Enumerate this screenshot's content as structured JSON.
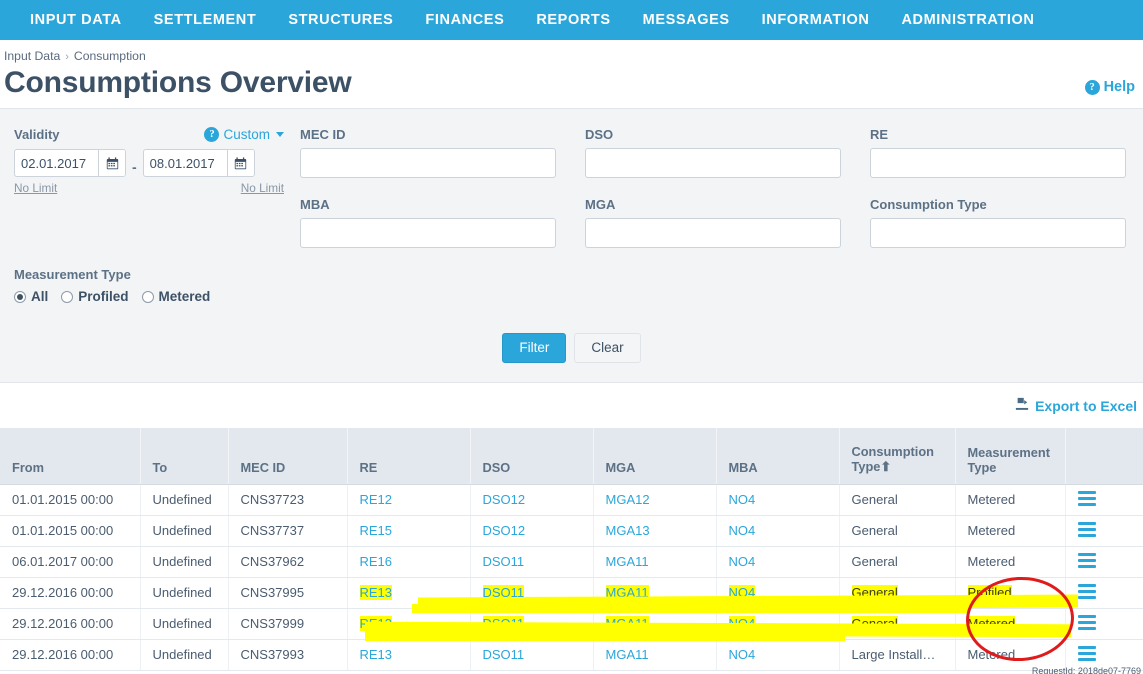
{
  "nav": {
    "items": [
      {
        "label": "INPUT DATA",
        "name": "nav-input-data"
      },
      {
        "label": "SETTLEMENT",
        "name": "nav-settlement"
      },
      {
        "label": "STRUCTURES",
        "name": "nav-structures"
      },
      {
        "label": "FINANCES",
        "name": "nav-finances"
      },
      {
        "label": "REPORTS",
        "name": "nav-reports"
      },
      {
        "label": "MESSAGES",
        "name": "nav-messages"
      },
      {
        "label": "INFORMATION",
        "name": "nav-information"
      },
      {
        "label": "ADMINISTRATION",
        "name": "nav-administration"
      }
    ]
  },
  "breadcrumb": {
    "root": "Input Data",
    "separator": "›",
    "current": "Consumption"
  },
  "header": {
    "title": "Consumptions Overview",
    "help_label": "Help",
    "help_icon": "question-circle-icon"
  },
  "filters": {
    "validity": {
      "label": "Validity",
      "preset_label": "Custom",
      "preset_icon": "question-circle-icon",
      "from_value": "02.01.2017",
      "to_value": "08.01.2017",
      "separator": "-",
      "no_limit_from": "No Limit",
      "no_limit_to": "No Limit",
      "calendar_icon": "calendar-icon"
    },
    "mec_id": {
      "label": "MEC ID",
      "value": "",
      "placeholder": ""
    },
    "dso": {
      "label": "DSO",
      "value": "",
      "placeholder": ""
    },
    "re": {
      "label": "RE",
      "value": "",
      "placeholder": ""
    },
    "mba": {
      "label": "MBA",
      "value": "",
      "placeholder": ""
    },
    "mga": {
      "label": "MGA",
      "value": "",
      "placeholder": ""
    },
    "consumption_type": {
      "label": "Consumption Type",
      "value": "",
      "placeholder": ""
    },
    "measurement_type": {
      "label": "Measurement Type",
      "options": [
        {
          "label": "All",
          "selected": true
        },
        {
          "label": "Profiled",
          "selected": false
        },
        {
          "label": "Metered",
          "selected": false
        }
      ]
    },
    "buttons": {
      "filter": "Filter",
      "clear": "Clear"
    }
  },
  "toolbar": {
    "export_label": "Export to Excel",
    "export_icon": "export-excel-icon"
  },
  "table": {
    "columns": [
      {
        "label": "From",
        "sorted": false
      },
      {
        "label": "To",
        "sorted": false
      },
      {
        "label": "MEC ID",
        "sorted": false
      },
      {
        "label": "RE",
        "sorted": false
      },
      {
        "label": "DSO",
        "sorted": false
      },
      {
        "label": "MGA",
        "sorted": false
      },
      {
        "label": "MBA",
        "sorted": false
      },
      {
        "label": "Consumption Type",
        "sorted": true,
        "sort_dir": "asc",
        "sort_glyph": "⬆"
      },
      {
        "label": "Measurement Type",
        "sorted": false
      },
      {
        "label": "",
        "sorted": false
      }
    ],
    "action_icon": "hamburger-menu-icon",
    "rows": [
      {
        "from": "01.01.2015 00:00",
        "to": "Undefined",
        "mec_id": "CNS37723",
        "re": "RE12",
        "dso": "DSO12",
        "mga": "MGA12",
        "mba": "NO4",
        "consumption_type": "General",
        "measurement_type": "Metered",
        "highlighted": false
      },
      {
        "from": "01.01.2015 00:00",
        "to": "Undefined",
        "mec_id": "CNS37737",
        "re": "RE15",
        "dso": "DSO12",
        "mga": "MGA13",
        "mba": "NO4",
        "consumption_type": "General",
        "measurement_type": "Metered",
        "highlighted": false
      },
      {
        "from": "06.01.2017 00:00",
        "to": "Undefined",
        "mec_id": "CNS37962",
        "re": "RE16",
        "dso": "DSO11",
        "mga": "MGA11",
        "mba": "NO4",
        "consumption_type": "General",
        "measurement_type": "Metered",
        "highlighted": false
      },
      {
        "from": "29.12.2016 00:00",
        "to": "Undefined",
        "mec_id": "CNS37995",
        "re": "RE13",
        "dso": "DSO11",
        "mga": "MGA11",
        "mba": "NO4",
        "consumption_type": "General",
        "measurement_type": "Profiled",
        "highlighted": true
      },
      {
        "from": "29.12.2016 00:00",
        "to": "Undefined",
        "mec_id": "CNS37999",
        "re": "RE13",
        "dso": "DSO11",
        "mga": "MGA11",
        "mba": "NO4",
        "consumption_type": "General",
        "measurement_type": "Metered",
        "highlighted": true
      },
      {
        "from": "29.12.2016 00:00",
        "to": "Undefined",
        "mec_id": "CNS37993",
        "re": "RE13",
        "dso": "DSO11",
        "mga": "MGA11",
        "mba": "NO4",
        "consumption_type": "Large Install…",
        "measurement_type": "Metered",
        "highlighted": false
      }
    ]
  },
  "annotations": {
    "highlight_color": "#ffff00",
    "circle_color": "#e01b1b",
    "circled_cells": [
      "Profiled",
      "Metered"
    ]
  },
  "footer": {
    "stamp": "RequestId: 2018de07-7769"
  },
  "colors": {
    "nav_background": "#2ba6da",
    "accent": "#2ba6da",
    "title_text": "#3d5166",
    "panel_background": "#f2f4f6",
    "table_header_background": "#e2e8ed"
  }
}
